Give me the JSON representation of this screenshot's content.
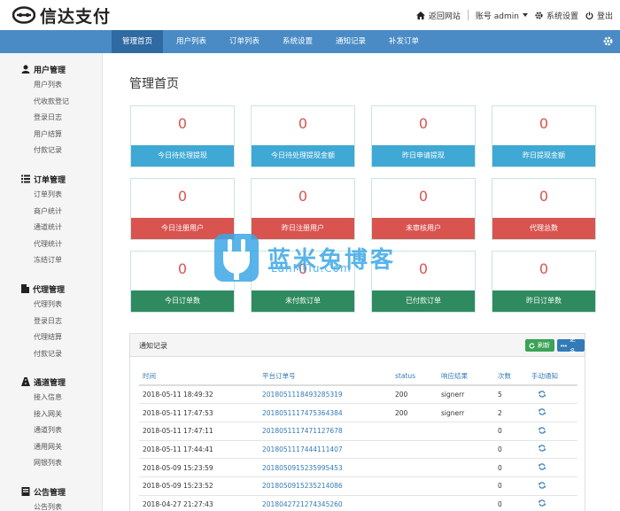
{
  "header": {
    "logo_text": "信达支付",
    "back_link": "返回网站",
    "account": "账号 admin",
    "settings": "系统设置",
    "logout": "登出"
  },
  "nav": {
    "items": [
      "管理首页",
      "用户列表",
      "订单列表",
      "系统设置",
      "通知记录",
      "补发订单"
    ],
    "active_index": 0
  },
  "sidebar": {
    "groups": [
      {
        "title": "用户管理",
        "icon": "user-icon",
        "items": [
          "用户列表",
          "代收款登记",
          "登录日志",
          "用户结算",
          "付款记录"
        ]
      },
      {
        "title": "订单管理",
        "icon": "list-icon",
        "items": [
          "订单列表",
          "商户统计",
          "通道统计",
          "代理统计",
          "冻结订单"
        ]
      },
      {
        "title": "代理管理",
        "icon": "file-icon",
        "items": [
          "代理列表",
          "登录日志",
          "代理结算",
          "付款记录"
        ]
      },
      {
        "title": "通道管理",
        "icon": "road-icon",
        "items": [
          "接入信息",
          "接入网关",
          "通道列表",
          "通用网关",
          "网银列表"
        ]
      },
      {
        "title": "公告管理",
        "icon": "book-icon",
        "items": [
          "公告列表"
        ]
      }
    ]
  },
  "main": {
    "title": "管理首页",
    "cards": [
      {
        "value": "0",
        "label": "今日待处理提现",
        "color": "#3fa8d4"
      },
      {
        "value": "0",
        "label": "今日待处理提现金额",
        "color": "#3fa8d4"
      },
      {
        "value": "0",
        "label": "昨日申请提现",
        "color": "#3fa8d4"
      },
      {
        "value": "0",
        "label": "昨日提现金额",
        "color": "#3fa8d4"
      },
      {
        "value": "0",
        "label": "今日注册用户",
        "color": "#d9534f"
      },
      {
        "value": "0",
        "label": "昨日注册用户",
        "color": "#d9534f"
      },
      {
        "value": "0",
        "label": "未审核用户",
        "color": "#d9534f"
      },
      {
        "value": "0",
        "label": "代理总数",
        "color": "#d9534f"
      },
      {
        "value": "0",
        "label": "今日订单数",
        "color": "#2f8a5f"
      },
      {
        "value": "0",
        "label": "未付款订单",
        "color": "#2f8a5f"
      },
      {
        "value": "0",
        "label": "已付款订单",
        "color": "#2f8a5f"
      },
      {
        "value": "0",
        "label": "昨日订单数",
        "color": "#2f8a5f"
      }
    ]
  },
  "notify": {
    "title": "通知记录",
    "refresh": "刷新",
    "more": "更多",
    "columns": [
      "时间",
      "平台订单号",
      "status",
      "响应结果",
      "次数",
      "手动通知"
    ],
    "rows": [
      [
        "2018-05-11 18:49:32",
        "2018051118493285319",
        "200",
        "signerr",
        "5"
      ],
      [
        "2018-05-11 17:47:53",
        "2018051117475364384",
        "200",
        "signerr",
        "2"
      ],
      [
        "2018-05-11 17:47:11",
        "2018051117471127678",
        "",
        "",
        "0"
      ],
      [
        "2018-05-11 17:44:41",
        "2018051117444111407",
        "",
        "",
        "0"
      ],
      [
        "2018-05-09 15:23:59",
        "2018050915235995453",
        "",
        "",
        "0"
      ],
      [
        "2018-05-09 15:23:52",
        "2018050915235214086",
        "",
        "",
        "0"
      ],
      [
        "2018-04-27 21:27:43",
        "2018042721274345260",
        "",
        "",
        "0"
      ]
    ]
  },
  "watermark": {
    "text": "蓝米兔博客",
    "sub": "LanMiTu.Com"
  },
  "colors": {
    "nav": "#4a8bc5",
    "nav_active": "#2f6aa2",
    "blue": "#3fa8d4",
    "red": "#d9534f",
    "green": "#2f8a5f",
    "link": "#337ab7"
  }
}
